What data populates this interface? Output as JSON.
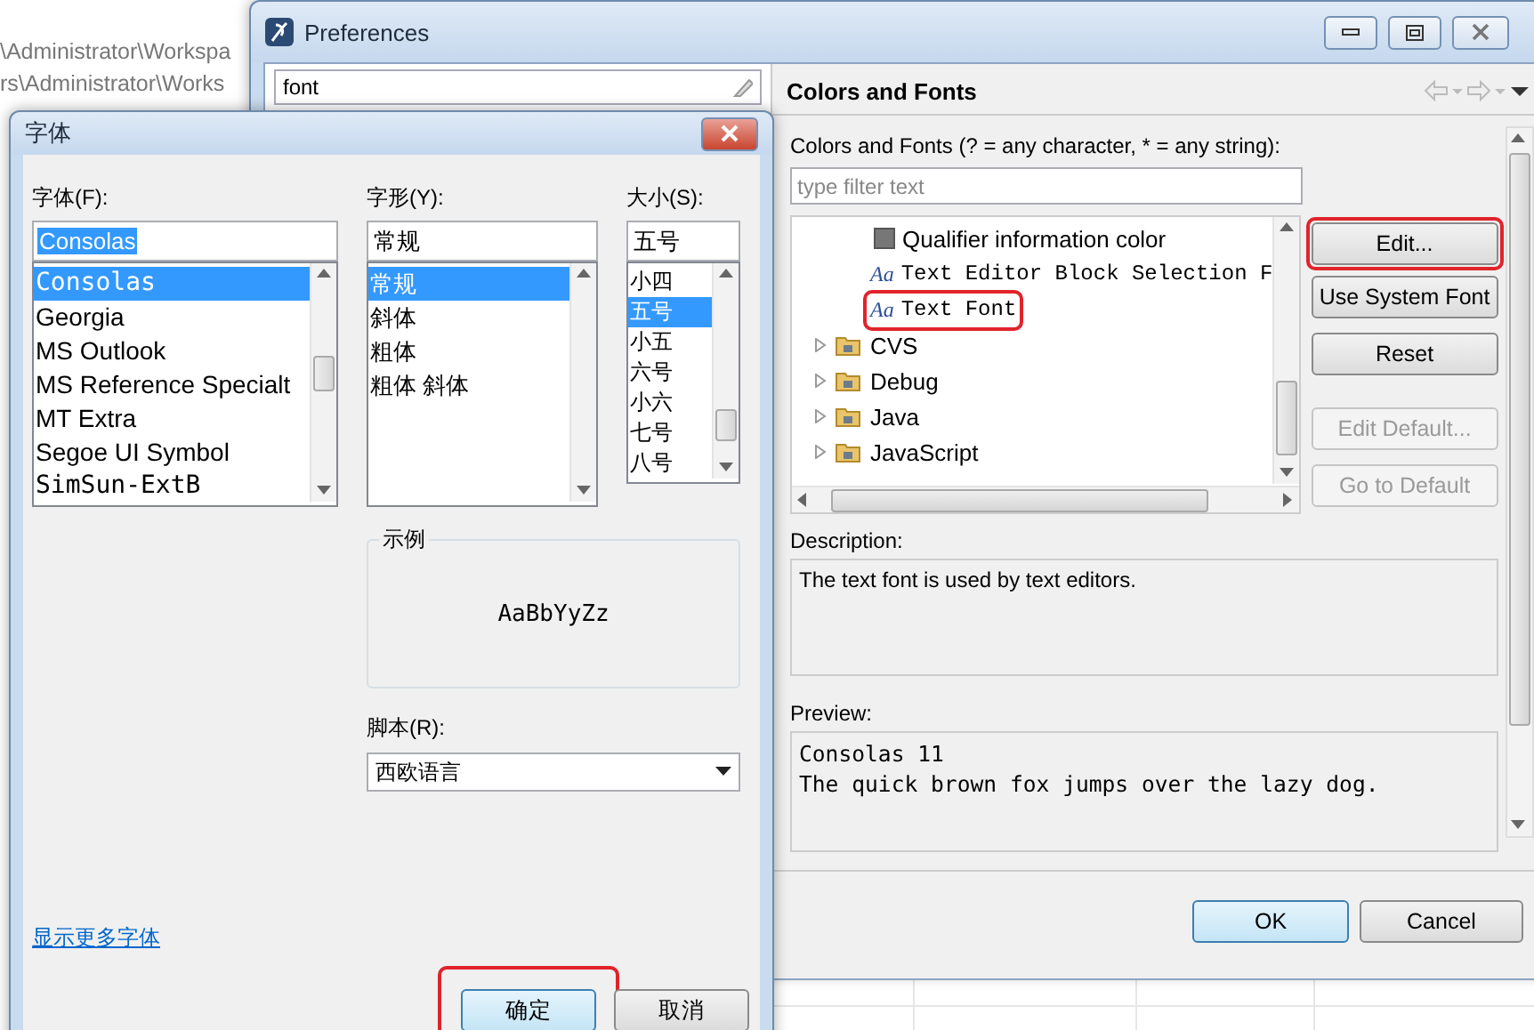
{
  "background": {
    "path_lines": [
      "\\Administrator\\Workspa",
      "rs\\Administrator\\Works"
    ]
  },
  "preferences": {
    "title": "Preferences",
    "search": {
      "value": "font"
    },
    "page_title": "Colors and Fonts",
    "filter_label": "Colors and Fonts (? = any character, * = any string):",
    "filter": {
      "placeholder": "type filter text"
    },
    "tree": [
      {
        "kind": "color",
        "label": "Qualifier information color",
        "highlighted": false
      },
      {
        "kind": "font",
        "glyph": "Aa",
        "label": "Text Editor Block Selection F",
        "highlighted": false
      },
      {
        "kind": "font",
        "glyph": "Aa",
        "label": "Text Font",
        "highlighted": true
      },
      {
        "kind": "category",
        "label": "CVS",
        "expanded": false,
        "highlighted": false
      },
      {
        "kind": "category",
        "label": "Debug",
        "expanded": false,
        "highlighted": false
      },
      {
        "kind": "category",
        "label": "Java",
        "expanded": false,
        "highlighted": false
      },
      {
        "kind": "category",
        "label": "JavaScript",
        "expanded": false,
        "highlighted": false
      }
    ],
    "buttons": [
      {
        "label": "Edit...",
        "disabled": false,
        "highlighted": true
      },
      {
        "label": "Use System Font",
        "disabled": false,
        "highlighted": false
      },
      {
        "label": "Reset",
        "disabled": false,
        "highlighted": false
      },
      {
        "label": "Edit Default...",
        "disabled": true,
        "highlighted": false
      },
      {
        "label": "Go to Default",
        "disabled": true,
        "highlighted": false
      }
    ],
    "description_label": "Description:",
    "description": "The text font is used by text editors.",
    "preview_label": "Preview:",
    "preview_lines": [
      "Consolas 11",
      "The quick brown fox jumps over the lazy dog."
    ],
    "dialog_buttons": [
      {
        "label": "OK",
        "default": true
      },
      {
        "label": "Cancel",
        "default": false
      }
    ]
  },
  "font_dialog": {
    "title": "字体",
    "columns": [
      {
        "label": "字体(F):",
        "value": "Consolas",
        "kind": "family",
        "items": [
          {
            "label": "Consolas",
            "selected": true
          },
          {
            "label": "Georgia",
            "selected": false
          },
          {
            "label": "MS Outlook",
            "selected": false
          },
          {
            "label": "MS Reference Specialt",
            "selected": false
          },
          {
            "label": "MT Extra",
            "selected": false
          },
          {
            "label": "Segoe UI Symbol",
            "selected": false
          },
          {
            "label": "SimSun-ExtB",
            "selected": false
          }
        ]
      },
      {
        "label": "字形(Y):",
        "value": "常规",
        "kind": "style",
        "items": [
          {
            "label": "常规",
            "selected": true
          },
          {
            "label": "斜体",
            "selected": false
          },
          {
            "label": "粗体",
            "selected": false
          },
          {
            "label": "粗体 斜体",
            "selected": false
          }
        ]
      },
      {
        "label": "大小(S):",
        "value": "五号",
        "kind": "size",
        "items": [
          {
            "label": "小四",
            "selected": false
          },
          {
            "label": "五号",
            "selected": true
          },
          {
            "label": "小五",
            "selected": false
          },
          {
            "label": "六号",
            "selected": false
          },
          {
            "label": "小六",
            "selected": false
          },
          {
            "label": "七号",
            "selected": false
          },
          {
            "label": "八号",
            "selected": false
          }
        ]
      }
    ],
    "sample_label": "示例",
    "sample_text": "AaBbYyZz",
    "script_label": "脚本(R):",
    "script_value": "西欧语言",
    "more_fonts_link": "显示更多字体",
    "buttons": [
      {
        "label": "确定",
        "default": true,
        "highlighted": true
      },
      {
        "label": "取消",
        "default": false,
        "highlighted": false
      }
    ]
  }
}
